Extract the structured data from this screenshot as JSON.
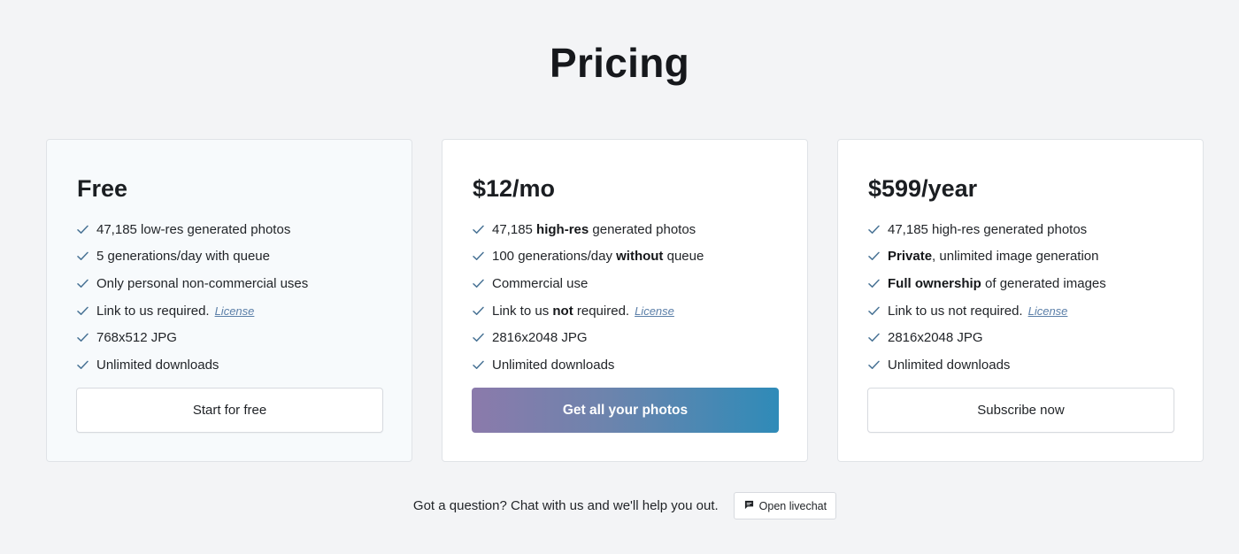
{
  "page": {
    "title": "Pricing"
  },
  "plans": [
    {
      "price": "Free",
      "features": [
        {
          "pre": "47,185 low-res generated photos",
          "bold": "",
          "post": "",
          "license": ""
        },
        {
          "pre": "5 generations/day with queue",
          "bold": "",
          "post": "",
          "license": ""
        },
        {
          "pre": "Only personal non-commercial uses",
          "bold": "",
          "post": "",
          "license": ""
        },
        {
          "pre": "Link to us required.",
          "bold": "",
          "post": "",
          "license": "License"
        },
        {
          "pre": "768x512 JPG",
          "bold": "",
          "post": "",
          "license": ""
        },
        {
          "pre": "Unlimited downloads",
          "bold": "",
          "post": "",
          "license": ""
        }
      ],
      "button": "Start for free"
    },
    {
      "price": "$12/mo",
      "features": [
        {
          "pre": "47,185 ",
          "bold": "high-res",
          "post": " generated photos",
          "license": ""
        },
        {
          "pre": "100 generations/day ",
          "bold": "without",
          "post": " queue",
          "license": ""
        },
        {
          "pre": "Commercial use",
          "bold": "",
          "post": "",
          "license": ""
        },
        {
          "pre": "Link to us ",
          "bold": "not",
          "post": " required.",
          "license": "License"
        },
        {
          "pre": "2816x2048 JPG",
          "bold": "",
          "post": "",
          "license": ""
        },
        {
          "pre": "Unlimited downloads",
          "bold": "",
          "post": "",
          "license": ""
        }
      ],
      "button": "Get all your photos"
    },
    {
      "price": "$599/year",
      "features": [
        {
          "pre": "47,185 high-res generated photos",
          "bold": "",
          "post": "",
          "license": ""
        },
        {
          "pre": "",
          "bold": "Private",
          "post": ", unlimited image generation",
          "license": ""
        },
        {
          "pre": "",
          "bold": "Full ownership",
          "post": " of generated images",
          "license": ""
        },
        {
          "pre": "Link to us not required.",
          "bold": "",
          "post": "",
          "license": "License"
        },
        {
          "pre": "2816x2048 JPG",
          "bold": "",
          "post": "",
          "license": ""
        },
        {
          "pre": "Unlimited downloads",
          "bold": "",
          "post": "",
          "license": ""
        }
      ],
      "button": "Subscribe now"
    }
  ],
  "footer": {
    "text": "Got a question? Chat with us and we'll help you out.",
    "chat_button": "Open livechat",
    "chat_icon": "chat-bubble-icon"
  },
  "colors": {
    "background": "#f3f4f6",
    "check": "#4a7496",
    "license_link": "#5b7fa8",
    "primary_gradient_start": "#8b7aab",
    "primary_gradient_end": "#2f8bb8"
  }
}
